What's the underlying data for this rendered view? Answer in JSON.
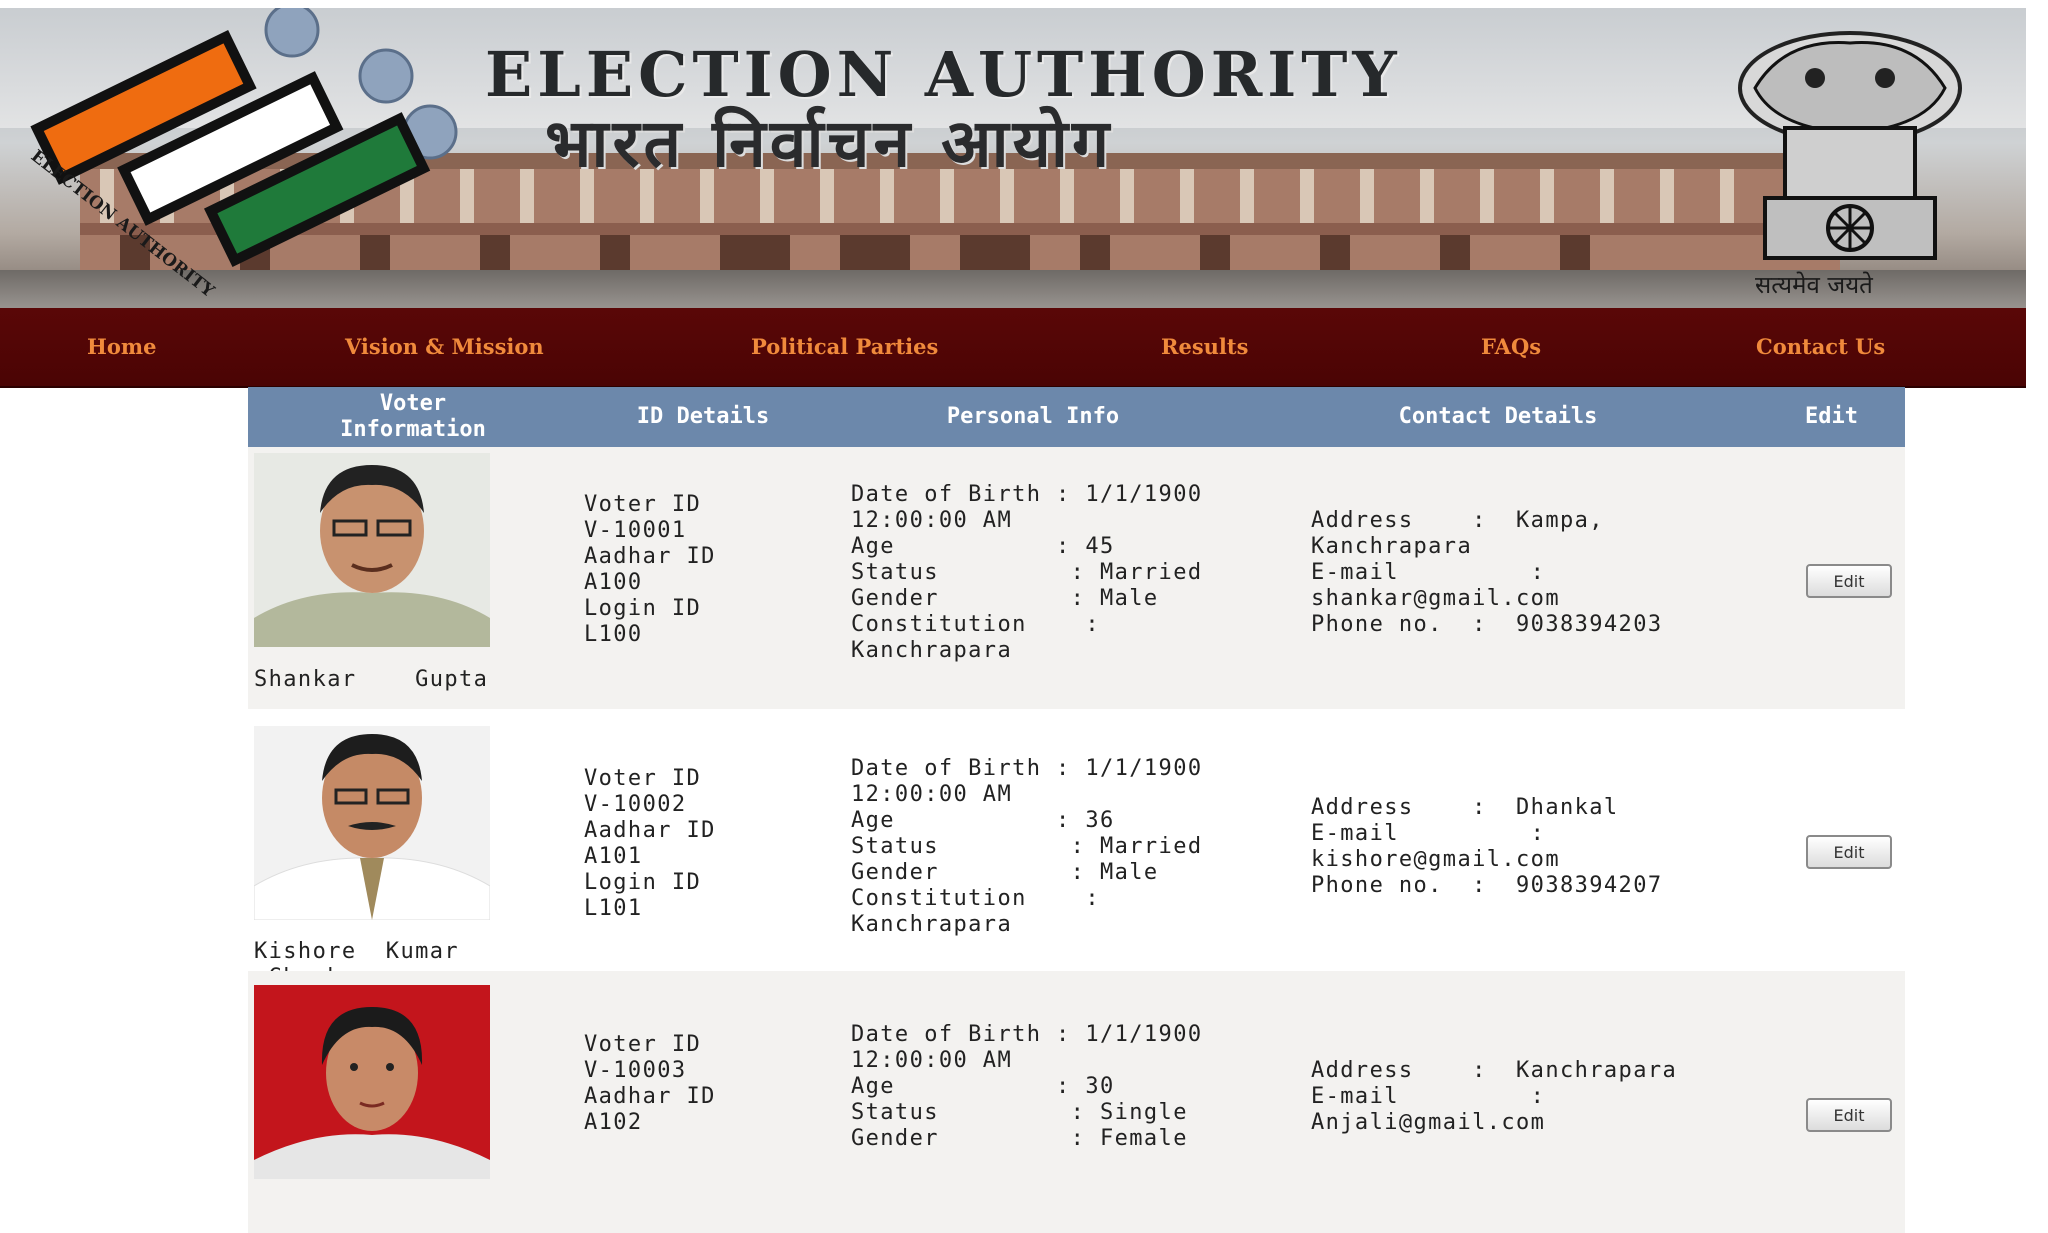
{
  "header": {
    "title_en": "ELECTION AUTHORITY",
    "title_hi": "भारत निर्वाचन आयोग",
    "logo_text": "ELECTION AUTHORITY",
    "motto": "सत्यमेव जयते"
  },
  "nav": {
    "items": [
      "Home",
      "Vision & Mission",
      "Political Parties",
      "Results",
      "FAQs",
      "Contact Us"
    ]
  },
  "table": {
    "headers": {
      "voter_info": "Voter\nInformation",
      "id_details": "ID Details",
      "personal_info": "Personal Info",
      "contact_details": "Contact Details",
      "edit": "Edit"
    },
    "rows": [
      {
        "name": "Shankar    Gupta",
        "id_text": "Voter ID\nV-10001\nAadhar ID\nA100\nLogin ID\nL100",
        "personal_text": "Date of Birth : 1/1/1900\n12:00:00 AM\nAge           : 45\nStatus         : Married\nGender         : Male\nConstitution    :\nKanchrapara",
        "contact_text": "Address    :  Kampa,\nKanchrapara\nE-mail         :\nshankar@gmail.com\nPhone no.  :  9038394203",
        "edit_label": "Edit"
      },
      {
        "name": "Kishore  Kumar\n Ghosh",
        "id_text": "Voter ID\nV-10002\nAadhar ID\nA101\nLogin ID\nL101",
        "personal_text": "Date of Birth : 1/1/1900\n12:00:00 AM\nAge           : 36\nStatus         : Married\nGender         : Male\nConstitution    :\nKanchrapara",
        "contact_text": "Address    :  Dhankal\nE-mail         :\nkishore@gmail.com\nPhone no.  :  9038394207",
        "edit_label": "Edit"
      },
      {
        "name": "",
        "id_text": "Voter ID\nV-10003\nAadhar ID\nA102",
        "personal_text": "Date of Birth : 1/1/1900\n12:00:00 AM\nAge           : 30\nStatus         : Single\nGender         : Female",
        "contact_text": "Address    :  Kanchrapara\nE-mail         :\nAnjali@gmail.com",
        "edit_label": "Edit"
      }
    ]
  },
  "colors": {
    "nav_bg": "#4f0505",
    "nav_text": "#f08a3c",
    "table_header_bg": "#6c88ab",
    "row_alt_bg": "#f3f2f0",
    "logo_orange": "#ef6c10",
    "logo_green": "#1f7a3a"
  },
  "icons": {
    "logo": "election-logo-icon",
    "emblem": "national-emblem-icon",
    "photo_placeholder": "person-photo"
  }
}
